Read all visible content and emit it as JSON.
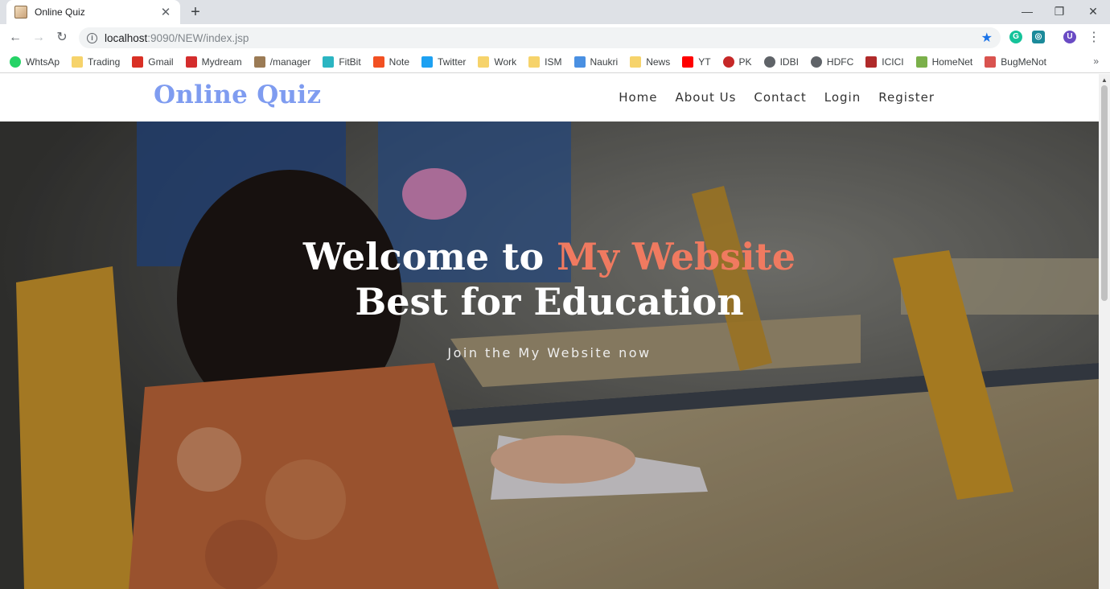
{
  "browser": {
    "tab_title": "Online Quiz",
    "url_host": "localhost",
    "url_path": ":9090/NEW/index.jsp",
    "profile_initial": "U",
    "accent_color": "#1a73e8",
    "bookmarks": [
      {
        "label": "WhtsAp",
        "icon": "whatsapp-icon",
        "color": "#25d366"
      },
      {
        "label": "Trading",
        "icon": "folder-icon",
        "color": "#f6d36b"
      },
      {
        "label": "Gmail",
        "icon": "gmail-icon",
        "color": "#d93025"
      },
      {
        "label": "Mydream",
        "icon": "vivaldi-icon",
        "color": "#d42d2d"
      },
      {
        "label": "/manager",
        "icon": "manager-icon",
        "color": "#9b7b55"
      },
      {
        "label": "FitBit",
        "icon": "fitbit-icon",
        "color": "#2bb5c2"
      },
      {
        "label": "Note",
        "icon": "microsoft-icon",
        "color": "#f25022"
      },
      {
        "label": "Twitter",
        "icon": "twitter-icon",
        "color": "#1da1f2"
      },
      {
        "label": "Work",
        "icon": "folder-icon",
        "color": "#f6d36b"
      },
      {
        "label": "ISM",
        "icon": "folder-icon",
        "color": "#f6d36b"
      },
      {
        "label": "Naukri",
        "icon": "naukri-icon",
        "color": "#4a90e2"
      },
      {
        "label": "News",
        "icon": "folder-icon",
        "color": "#f6d36b"
      },
      {
        "label": "YT",
        "icon": "youtube-icon",
        "color": "#ff0000"
      },
      {
        "label": "PK",
        "icon": "pk-icon",
        "color": "#c62828"
      },
      {
        "label": "IDBI",
        "icon": "globe-icon",
        "color": "#5f6368"
      },
      {
        "label": "HDFC",
        "icon": "globe-icon",
        "color": "#5f6368"
      },
      {
        "label": "ICICI",
        "icon": "icici-icon",
        "color": "#b02a2a"
      },
      {
        "label": "HomeNet",
        "icon": "homenet-icon",
        "color": "#7bb04a"
      },
      {
        "label": "BugMeNot",
        "icon": "bugmenot-icon",
        "color": "#d9534f"
      }
    ],
    "more_label": "»"
  },
  "site": {
    "brand": "Online Quiz",
    "brand_color": "#7f9cf0",
    "nav": [
      "Home",
      "About Us",
      "Contact",
      "Login",
      "Register"
    ],
    "hero": {
      "line1_prefix": "Welcome to ",
      "line1_accent": "My Website",
      "line2": "Best for Education",
      "subtitle": "Join the My Website now",
      "accent_color": "#f07a60"
    }
  }
}
